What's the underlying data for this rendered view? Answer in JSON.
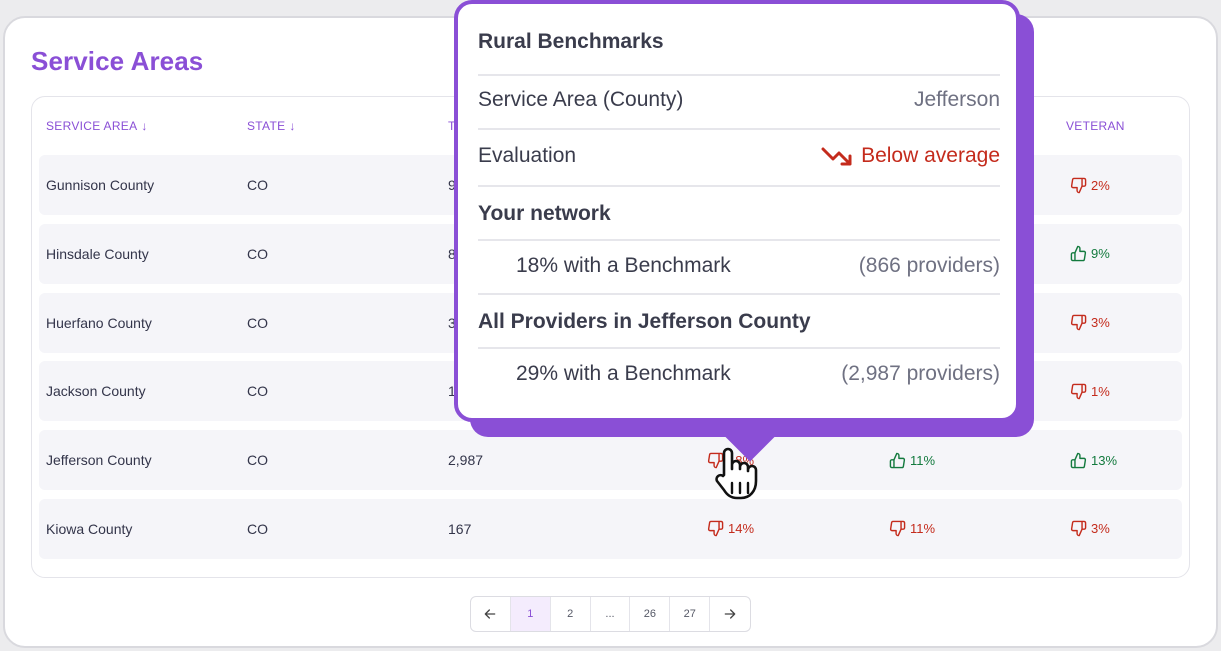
{
  "page": {
    "title": "Service Areas"
  },
  "table": {
    "headers": [
      {
        "label": "SERVICE AREA",
        "sortable": true
      },
      {
        "label": "STATE",
        "sortable": true
      },
      {
        "label": "T",
        "sortable": false
      },
      {
        "label": "VETERAN",
        "sortable": false
      }
    ],
    "rows": [
      {
        "area": "Gunnison County",
        "state": "CO",
        "total": "9",
        "veteran": {
          "value": "2%",
          "status": "bad"
        }
      },
      {
        "area": "Hinsdale County",
        "state": "CO",
        "total": "8",
        "veteran": {
          "value": "9%",
          "status": "good"
        }
      },
      {
        "area": "Huerfano County",
        "state": "CO",
        "total": "3",
        "veteran": {
          "value": "3%",
          "status": "bad"
        }
      },
      {
        "area": "Jackson County",
        "state": "CO",
        "total": "1",
        "veteran": {
          "value": "1%",
          "status": "bad"
        }
      },
      {
        "area": "Jefferson County",
        "state": "CO",
        "total": "2,987",
        "rural": {
          "value": "18%",
          "status": "bad"
        },
        "col5": {
          "value": "11%",
          "status": "good"
        },
        "veteran": {
          "value": "13%",
          "status": "good"
        }
      },
      {
        "area": "Kiowa County",
        "state": "CO",
        "total": "167",
        "rural": {
          "value": "14%",
          "status": "bad"
        },
        "col5": {
          "value": "11%",
          "status": "bad"
        },
        "veteran": {
          "value": "3%",
          "status": "bad"
        }
      }
    ]
  },
  "pagination": {
    "pages": [
      "1",
      "2",
      "...",
      "26",
      "27"
    ],
    "active": "1",
    "prev_icon": "arrow-left-icon",
    "next_icon": "arrow-right-icon"
  },
  "tooltip": {
    "title": "Rural Benchmarks",
    "service_area_label": "Service Area (County)",
    "service_area_value": "Jefferson",
    "evaluation_label": "Evaluation",
    "evaluation_value": "Below average",
    "your_network_heading": "Your network",
    "your_network_pct": "18% with a Benchmark",
    "your_network_count": "(866 providers)",
    "all_providers_heading": "All Providers in Jefferson County",
    "all_providers_pct": "29% with a Benchmark",
    "all_providers_count": "(2,987 providers)"
  },
  "colors": {
    "accent": "#8a4fd6",
    "bad": "#c42b1c",
    "good": "#137a3e"
  }
}
